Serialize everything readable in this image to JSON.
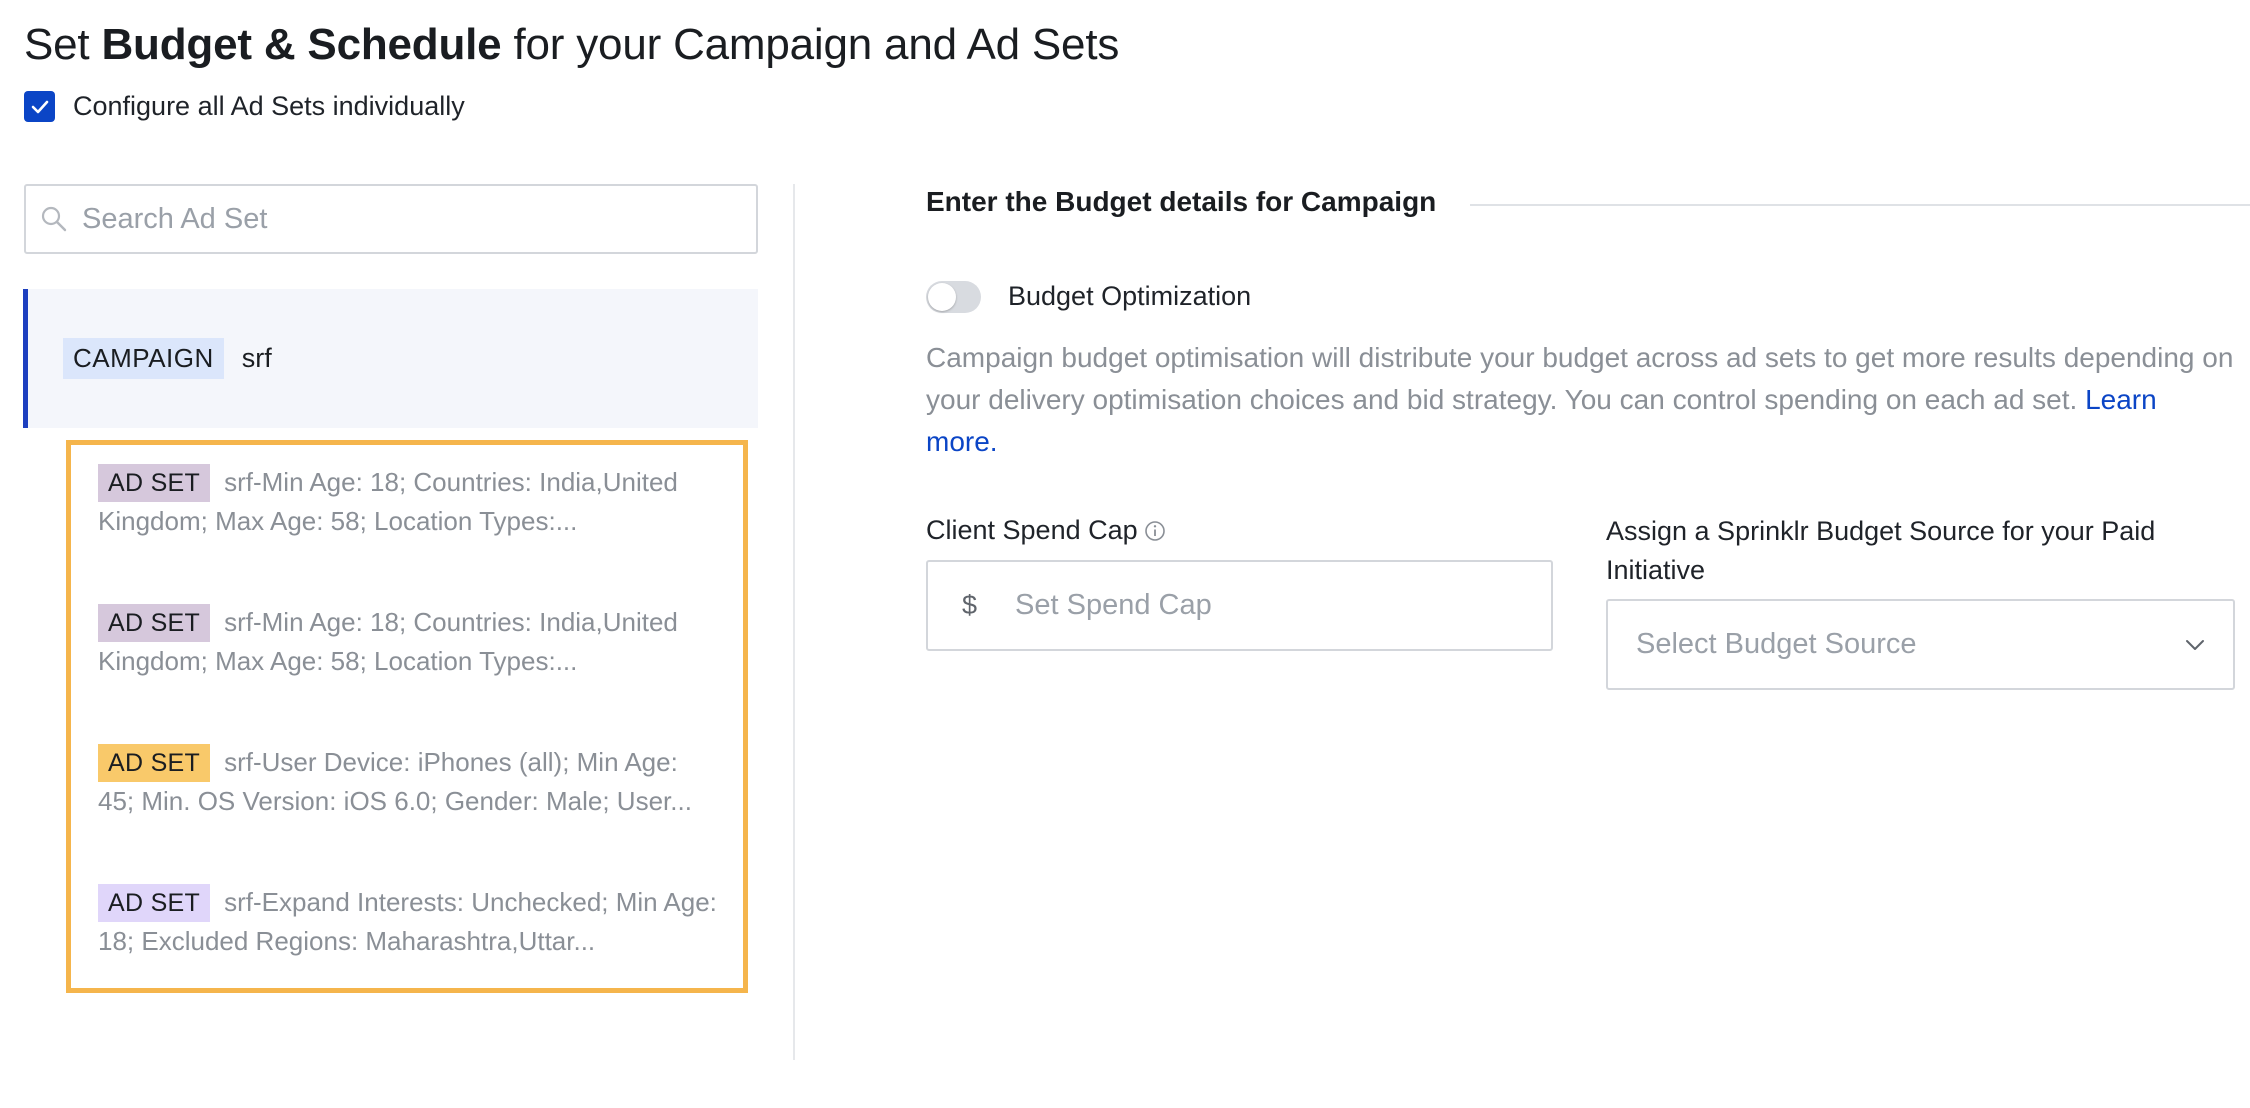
{
  "header": {
    "title_prefix": "Set ",
    "title_bold": "Budget & Schedule",
    "title_suffix": " for your Campaign and Ad Sets"
  },
  "configure_all": {
    "label": "Configure all Ad Sets individually",
    "checked": true
  },
  "search": {
    "placeholder": "Search Ad Set",
    "value": ""
  },
  "campaign": {
    "tag": "CAMPAIGN",
    "name": "srf"
  },
  "ad_sets": [
    {
      "tag": "AD SET",
      "tag_color": "#d6c8dc",
      "text": "srf-Min Age: 18; Countries: India,United Kingdom; Max Age: 58; Location Types:..."
    },
    {
      "tag": "AD SET",
      "tag_color": "#d6c8dc",
      "text": "srf-Min Age: 18; Countries: India,United Kingdom; Max Age: 58; Location Types:..."
    },
    {
      "tag": "AD SET",
      "tag_color": "#f9c96a",
      "text": "srf-User Device: iPhones (all); Min Age: 45; Min. OS Version: iOS 6.0; Gender: Male; User..."
    },
    {
      "tag": "AD SET",
      "tag_color": "#e0d6fa",
      "text": "srf-Expand Interests: Unchecked; Min Age: 18; Excluded Regions: Maharashtra,Uttar..."
    }
  ],
  "budget_section": {
    "heading": "Enter the Budget details for Campaign",
    "optimization_label": "Budget Optimization",
    "optimization_enabled": false,
    "description": "Campaign budget optimisation will distribute your budget across ad sets to get more results depending on your delivery optimisation choices and bid strategy. You can control spending on each ad set. ",
    "learn_more": "Learn more.",
    "spend_cap_label": "Client Spend Cap",
    "currency_symbol": "$",
    "spend_cap_placeholder": "Set Spend Cap",
    "budget_source_label": "Assign a Sprinklr Budget Source for your Paid Initiative",
    "budget_source_placeholder": "Select Budget Source"
  },
  "colors": {
    "accent": "#0b45c6",
    "highlight_border": "#f5b54c",
    "campaign_tag_bg": "#dbe6fb"
  }
}
